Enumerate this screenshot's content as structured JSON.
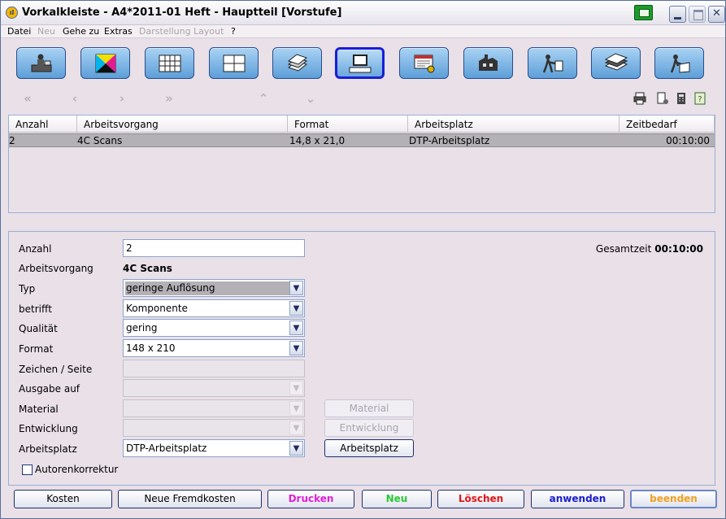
{
  "window": {
    "title": "Vorkalkleiste - A4*2011-01 Heft - Hauptteil [Vorstufe]"
  },
  "menu": [
    {
      "label": "Datei",
      "disabled": false
    },
    {
      "label": "Neu",
      "disabled": true
    },
    {
      "label": "Gehe zu",
      "disabled": false
    },
    {
      "label": "Extras",
      "disabled": false
    },
    {
      "label": "Darstellung",
      "disabled": true
    },
    {
      "label": "Layout",
      "disabled": true
    },
    {
      "label": "?",
      "disabled": false
    }
  ],
  "toolbar": {
    "buttons": [
      {
        "icon": "desk-worker-icon"
      },
      {
        "icon": "cmyk-icon"
      },
      {
        "icon": "grid-icon"
      },
      {
        "icon": "page-layout-icon"
      },
      {
        "icon": "paper-stack-icon"
      },
      {
        "icon": "computer-icon",
        "active": true
      },
      {
        "icon": "screen-settings-icon"
      },
      {
        "icon": "factory-icon"
      },
      {
        "icon": "worker-icon"
      },
      {
        "icon": "book-stack-icon"
      },
      {
        "icon": "packer-icon"
      }
    ]
  },
  "nav": {
    "first": "«",
    "prev": "‹",
    "next": "›",
    "last": "»",
    "up": "⌃",
    "down": "⌄"
  },
  "table": {
    "headers": [
      "Anzahl",
      "Arbeitsvorgang",
      "Format",
      "Arbeitsplatz",
      "Zeitbedarf"
    ],
    "rows": [
      [
        "2",
        "4C Scans",
        "14,8 x 21,0",
        "DTP-Arbeitsplatz",
        "00:10:00"
      ]
    ]
  },
  "form": {
    "gesamtzeit_label": "Gesamtzeit",
    "gesamtzeit_value": "00:10:00",
    "anzahl_label": "Anzahl",
    "anzahl_value": "2",
    "arbeitsvorgang_label": "Arbeitsvorgang",
    "arbeitsvorgang_value": "4C Scans",
    "typ_label": "Typ",
    "typ_value": "geringe Auflösung",
    "betrifft_label": "betrifft",
    "betrifft_value": "Komponente",
    "qualitaet_label": "Qualität",
    "qualitaet_value": "gering",
    "format_label": "Format",
    "format_value": "148 x 210",
    "zeichen_label": "Zeichen / Seite",
    "ausgabe_label": "Ausgabe auf",
    "material_label": "Material",
    "entwicklung_label": "Entwicklung",
    "arbeitsplatz_label": "Arbeitsplatz",
    "arbeitsplatz_value": "DTP-Arbeitsplatz",
    "material_button": "Material",
    "entwicklung_button": "Entwicklung",
    "arbeitsplatz_button": "Arbeitsplatz",
    "autorenkorrektur_label": "Autorenkorrektur",
    "autorenkorrektur_checked": false
  },
  "buttons": {
    "kosten": "Kosten",
    "fremdkosten": "Neue Fremdkosten",
    "drucken": "Drucken",
    "neu": "Neu",
    "loeschen": "Löschen",
    "anwenden": "anwenden",
    "beenden": "beenden"
  },
  "colors": {
    "drucken": "#e020d8",
    "neu": "#2cc838",
    "loeschen": "#e01818",
    "anwenden": "#1a1ec8",
    "beenden": "#f0a020"
  }
}
